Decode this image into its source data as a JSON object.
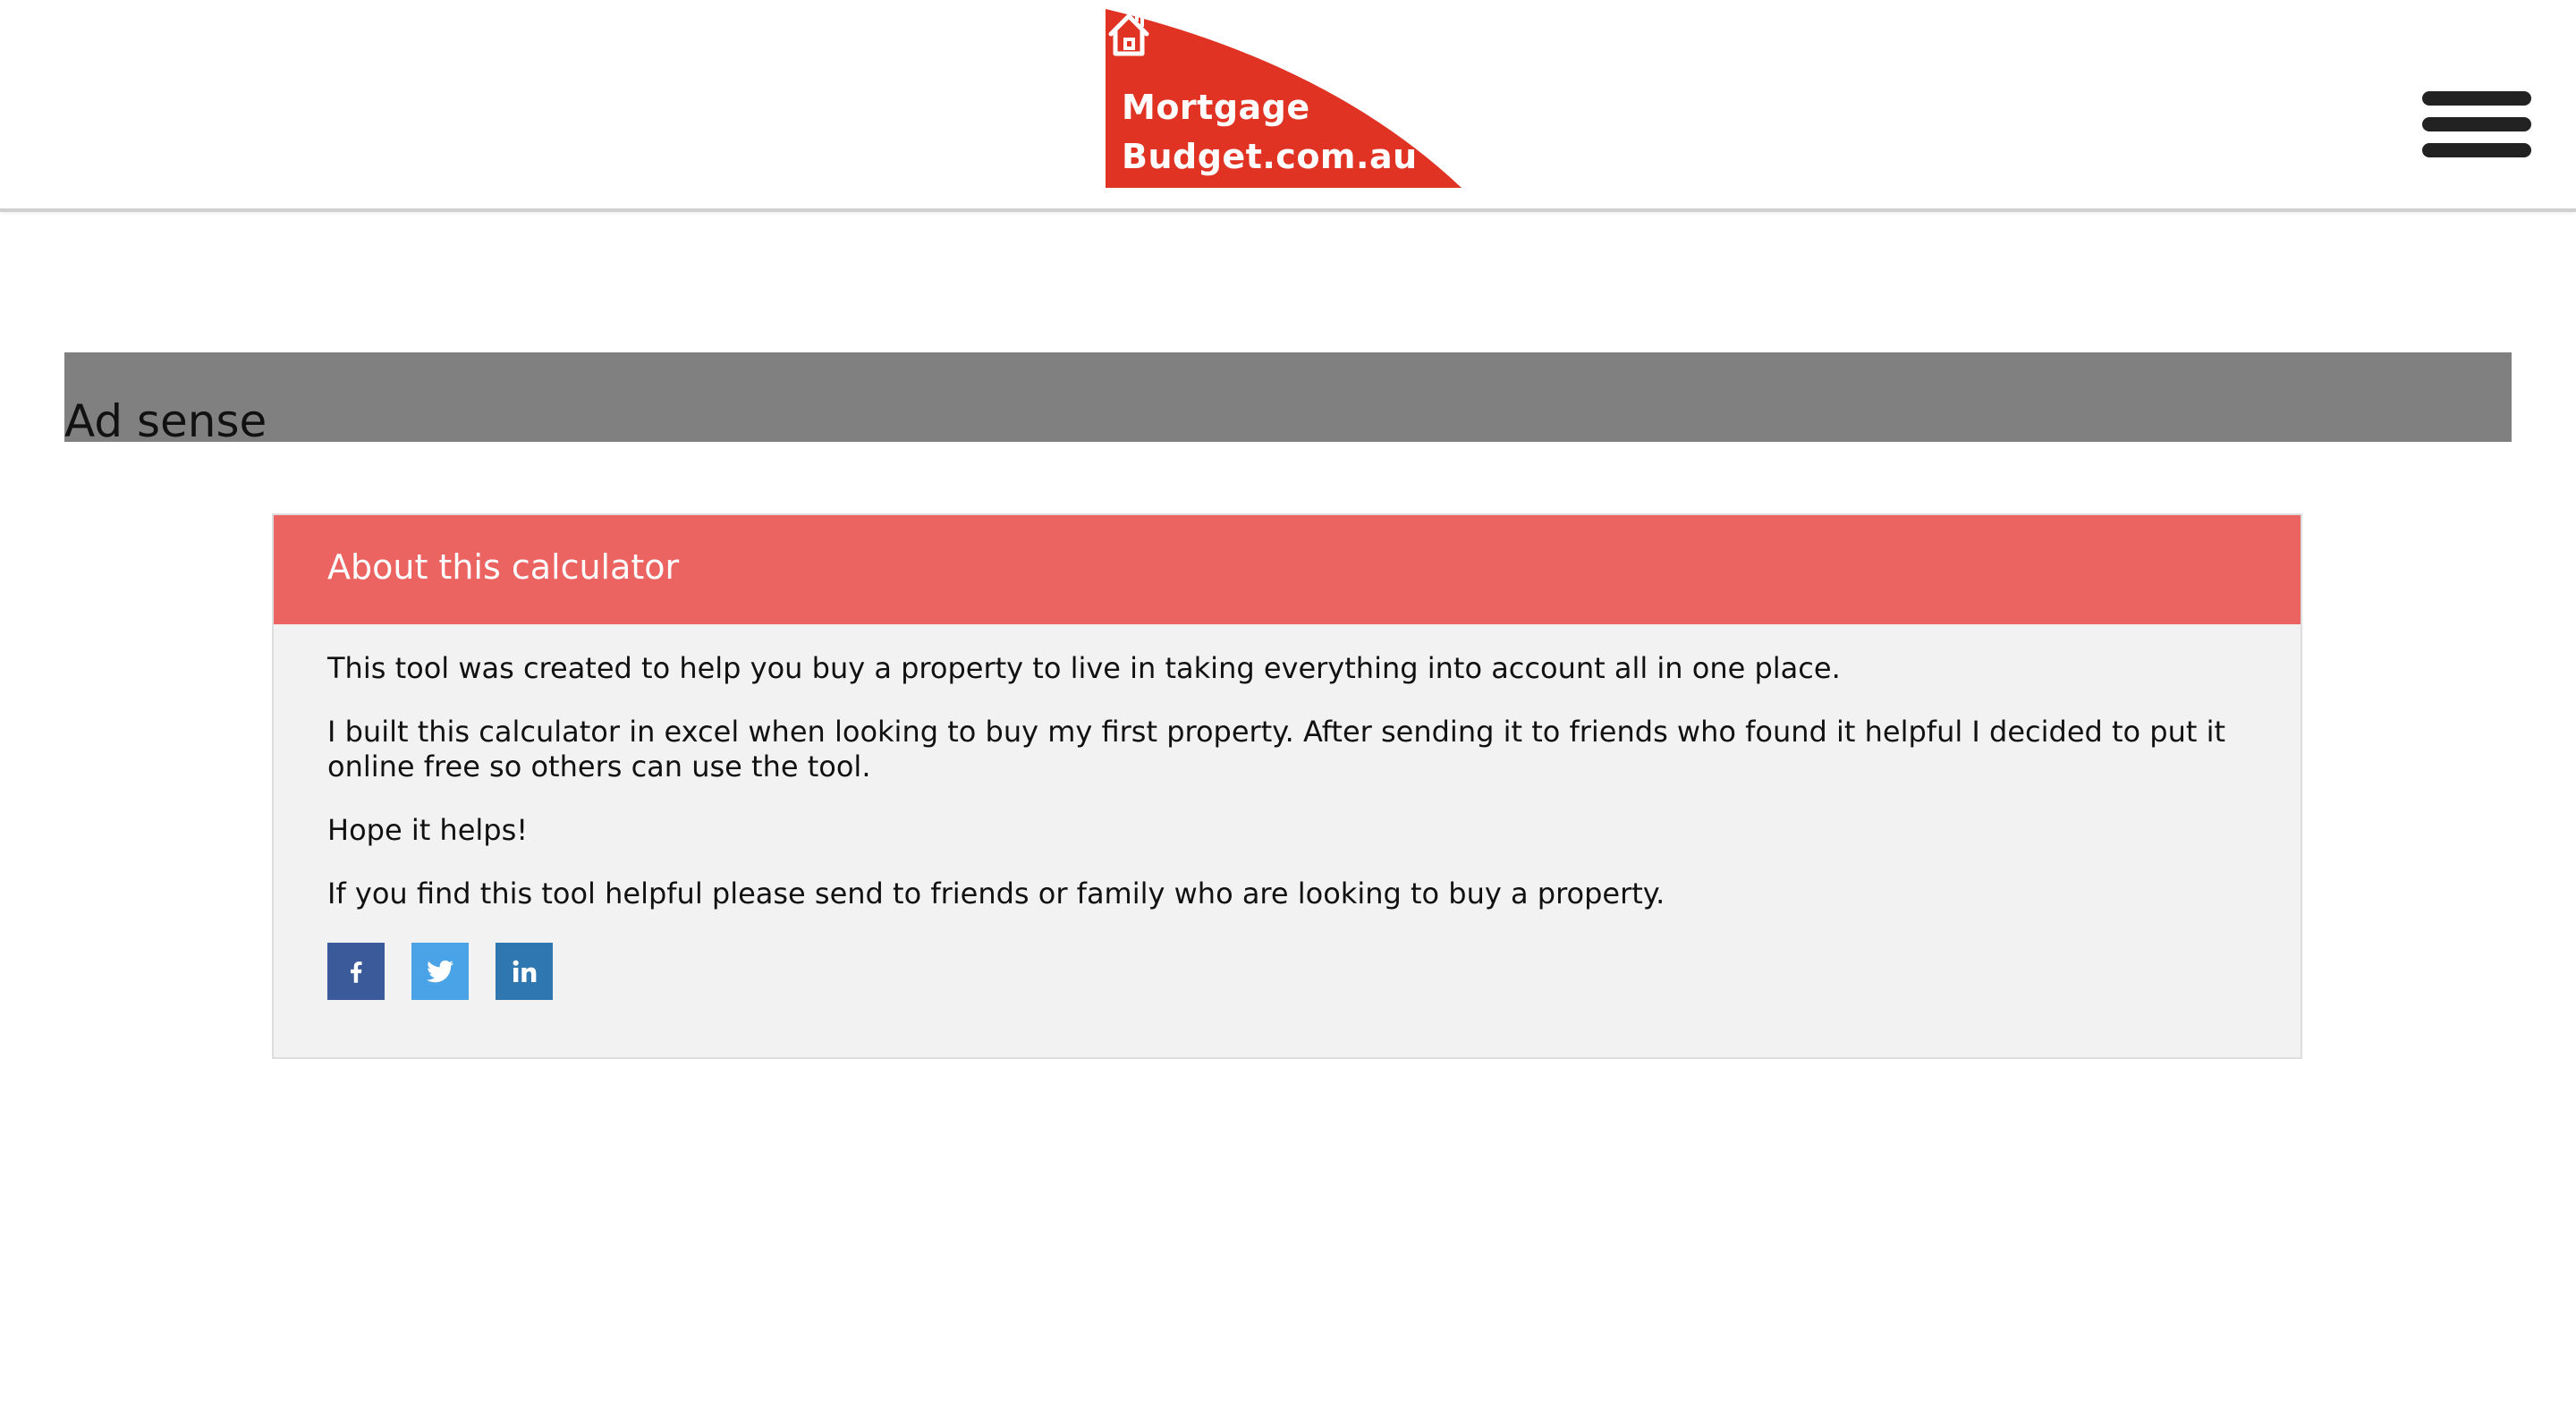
{
  "header": {
    "logo": {
      "line1": "Mortgage",
      "line2": "Budget.com.au",
      "icon": "house-icon",
      "color": "#e03324"
    },
    "menu_icon": "hamburger-menu-icon"
  },
  "ad": {
    "label": "Ad sense",
    "color": "#808080"
  },
  "about": {
    "title": "About this calculator",
    "header_color": "#ec6461",
    "paragraphs": [
      "This tool was created to help you buy a property to live in taking everything into account all in one place.",
      "I built this calculator in excel when looking to buy my first property. After sending it to friends who found it helpful I decided to put it online free so others can use the tool.",
      "Hope it helps!",
      "If you find this tool helpful please send to friends or family who are looking to buy a property."
    ],
    "share": [
      {
        "icon": "facebook-icon",
        "color": "#3b5a9a"
      },
      {
        "icon": "twitter-icon",
        "color": "#4aa3e6"
      },
      {
        "icon": "linkedin-icon",
        "color": "#2f77b1"
      }
    ]
  }
}
